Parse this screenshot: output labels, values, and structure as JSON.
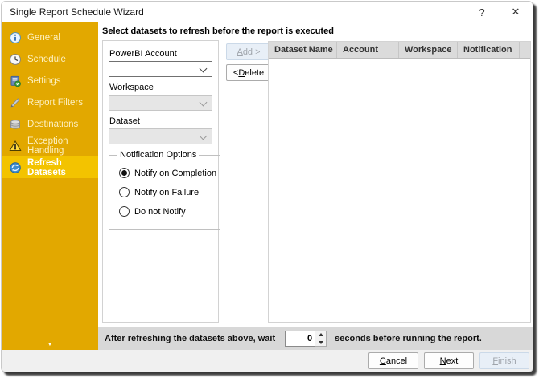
{
  "window": {
    "title": "Single Report Schedule Wizard",
    "help_icon": "?",
    "close_icon": "✕"
  },
  "sidebar": {
    "items": [
      {
        "label": "General",
        "icon": "info-icon",
        "selected": false
      },
      {
        "label": "Schedule",
        "icon": "clock-icon",
        "selected": false
      },
      {
        "label": "Settings",
        "icon": "settings-book-icon",
        "selected": false
      },
      {
        "label": "Report Filters",
        "icon": "pencil-icon",
        "selected": false
      },
      {
        "label": "Destinations",
        "icon": "disk-icon",
        "selected": false
      },
      {
        "label": "Exception Handling",
        "icon": "warning-icon",
        "selected": false
      },
      {
        "label": "Refresh Datasets",
        "icon": "refresh-globe-icon",
        "selected": true
      }
    ],
    "scroll_down_icon": "▼"
  },
  "main": {
    "heading": "Select datasets to refresh before the report is executed",
    "form": {
      "powerbi_account_label": "PowerBI Account",
      "powerbi_account_value": "",
      "workspace_label": "Workspace",
      "workspace_value": "",
      "dataset_label": "Dataset",
      "dataset_value": "",
      "notification_group_label": "Notification Options",
      "radios": [
        {
          "label": "Notify on Completion",
          "checked": true
        },
        {
          "label": "Notify on Failure",
          "checked": false
        },
        {
          "label": "Do not Notify",
          "checked": false
        }
      ]
    },
    "buttons": {
      "add": {
        "label": "Add >",
        "mnemonic": "A",
        "enabled": false
      },
      "delete": {
        "label": "< Delete",
        "mnemonic": "D",
        "enabled": true
      }
    },
    "table": {
      "columns": [
        "Dataset Name",
        "Account",
        "Workspace",
        "Notification"
      ],
      "rows": []
    },
    "wait_bar": {
      "prefix": "After refreshing the datasets above, wait",
      "value": "0",
      "suffix": "seconds before running the report."
    }
  },
  "footer": {
    "cancel": {
      "label": "Cancel",
      "mnemonic": "C",
      "enabled": true
    },
    "next": {
      "label": "Next",
      "mnemonic": "N",
      "enabled": true
    },
    "finish": {
      "label": "Finish",
      "mnemonic": "F",
      "enabled": false
    }
  },
  "colors": {
    "sidebar_bg": "#e2a800",
    "sidebar_selected_bg": "#f3c300",
    "disabled_button_bg": "#e8eff7",
    "table_header_bg": "#dbdbdb",
    "wait_strip_bg": "#d8d8d8",
    "footer_bg": "#f0f0f0"
  }
}
